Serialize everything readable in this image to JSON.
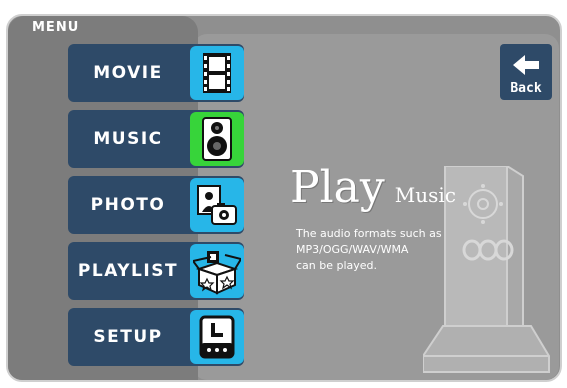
{
  "menu": {
    "title": "MENU",
    "items": [
      {
        "label": "MOVIE",
        "icon": "film-icon",
        "icon_color": "#27b6e8"
      },
      {
        "label": "MUSIC",
        "icon": "speaker-icon",
        "icon_color": "#37d43a"
      },
      {
        "label": "PHOTO",
        "icon": "photo-camera-icon",
        "icon_color": "#27b6e8"
      },
      {
        "label": "PLAYLIST",
        "icon": "box-icon",
        "icon_color": "#27b6e8"
      },
      {
        "label": "SETUP",
        "icon": "clock-settings-icon",
        "icon_color": "#27b6e8"
      }
    ]
  },
  "back": {
    "label": "Back",
    "icon": "back-arrow-icon"
  },
  "content": {
    "title": "Play",
    "subtitle": "Music",
    "description_lines": [
      "The audio formats such as",
      "MP3/OGG/WAV/WMA",
      "can be played."
    ],
    "illustration": "media-player-device-icon"
  },
  "colors": {
    "button_bg": "#2e4a68",
    "icon_blue": "#27b6e8",
    "icon_green_selected": "#37d43a",
    "panel_gray": "#8f8f8f"
  }
}
